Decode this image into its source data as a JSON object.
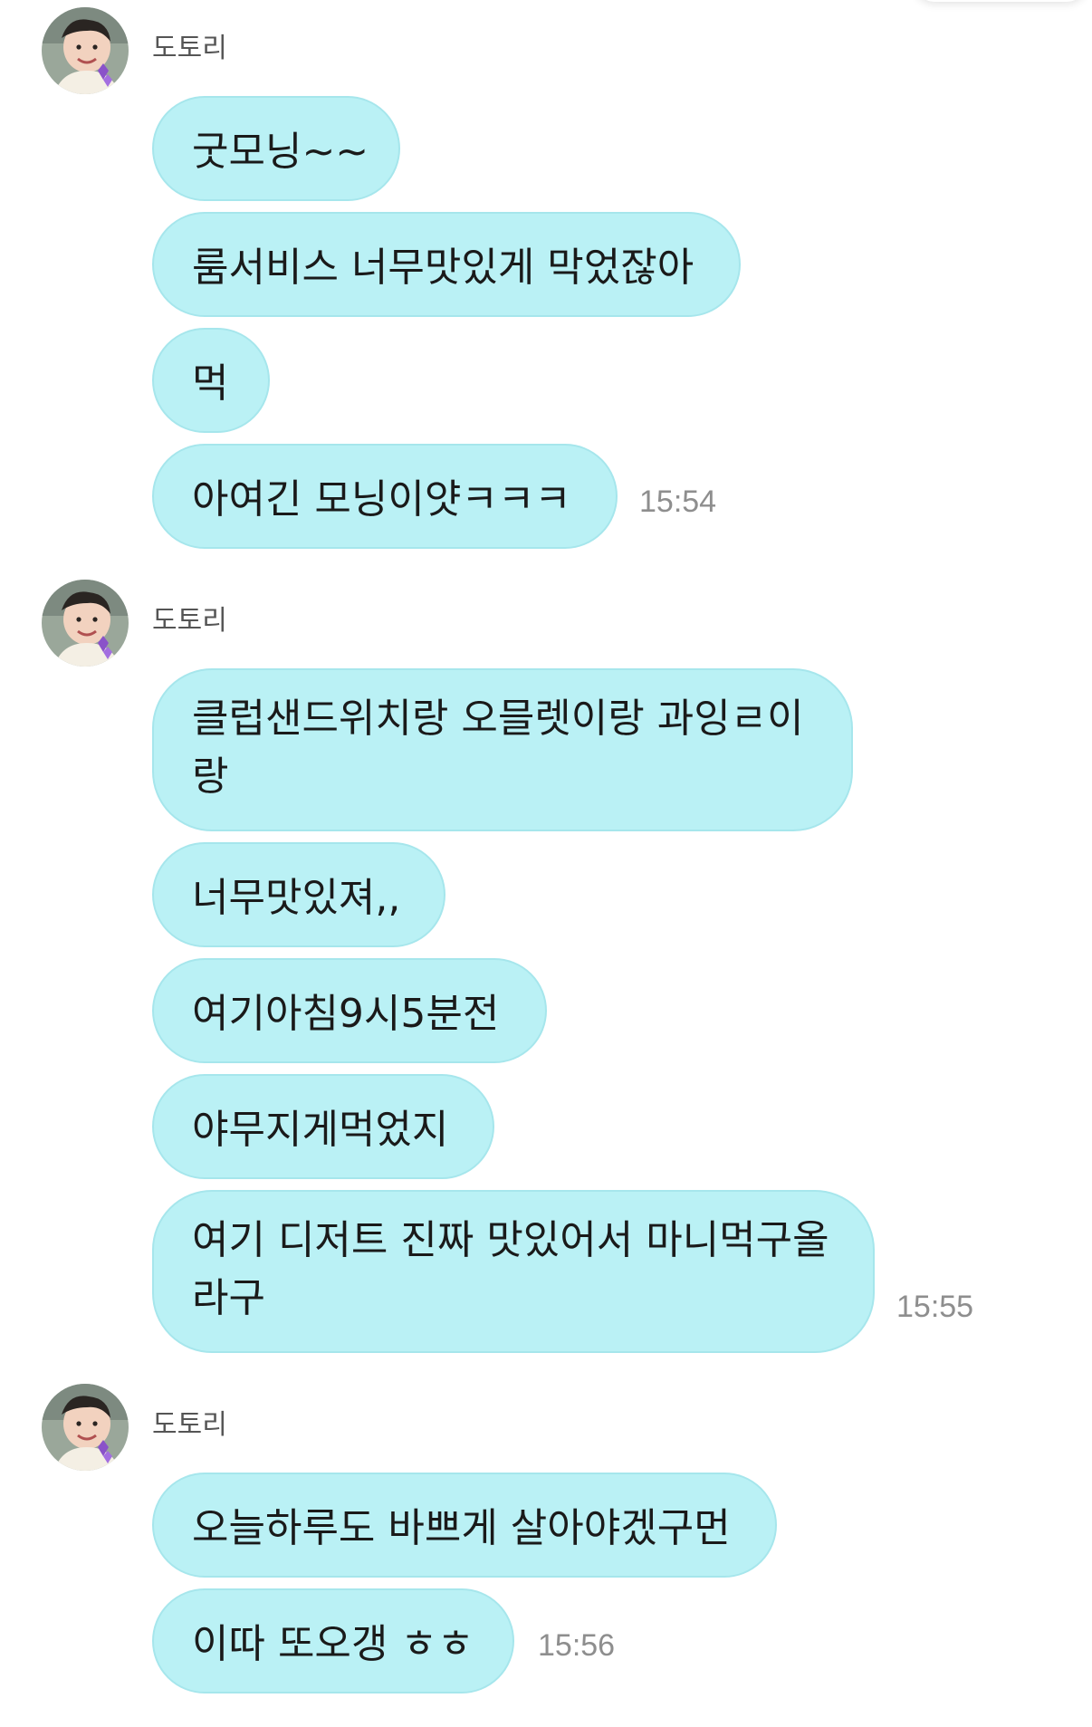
{
  "app": {
    "colors": {
      "bubble": "#baf1f5",
      "bubble_border": "#a6e6ec",
      "text": "#1a1a1a",
      "name": "#555555",
      "time": "#8e8e8e",
      "background": "#ffffff"
    }
  },
  "chat": {
    "groups": [
      {
        "sender": "도토리",
        "avatar": "child-profile-photo",
        "time": "15:54",
        "messages": [
          "굿모닝~~",
          "룸서비스 너무맛있게 막었잖아",
          "먹",
          "아여긴 모닝이얏ㅋㅋㅋ"
        ]
      },
      {
        "sender": "도토리",
        "avatar": "child-profile-photo",
        "time": "15:55",
        "messages": [
          "클럽샌드위치랑 오믈렛이랑 과잉ㄹ이랑",
          "너무맛있져,,",
          "여기아침9시5분전",
          "야무지게먹었지",
          "여기 디저트 진짜 맛있어서 마니먹구올라구"
        ]
      },
      {
        "sender": "도토리",
        "avatar": "child-profile-photo",
        "time": "15:56",
        "messages": [
          "오늘하루도 바쁘게 살아야겠구먼",
          "이따 또오갱 ㅎㅎ"
        ]
      }
    ]
  }
}
